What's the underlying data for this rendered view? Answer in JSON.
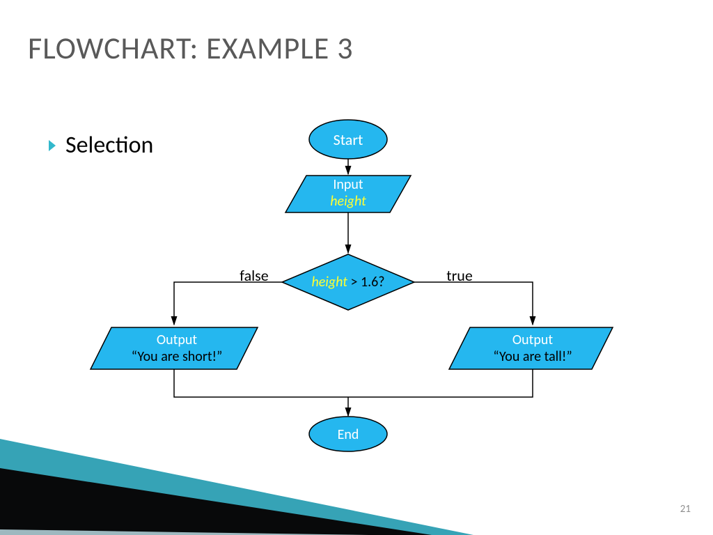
{
  "title": "FLOWCHART: EXAMPLE 3",
  "subtitle": "Selection",
  "nodes": {
    "start": "Start",
    "input_label": "Input",
    "input_var": "height",
    "decision_var": "height",
    "decision_cond": " > 1.6?",
    "false": "false",
    "true": "true",
    "out_left_label": "Output",
    "out_left_text": "“You are short!”",
    "out_right_label": "Output",
    "out_right_text": "“You are tall!”",
    "end": "End"
  },
  "page_number": "21"
}
